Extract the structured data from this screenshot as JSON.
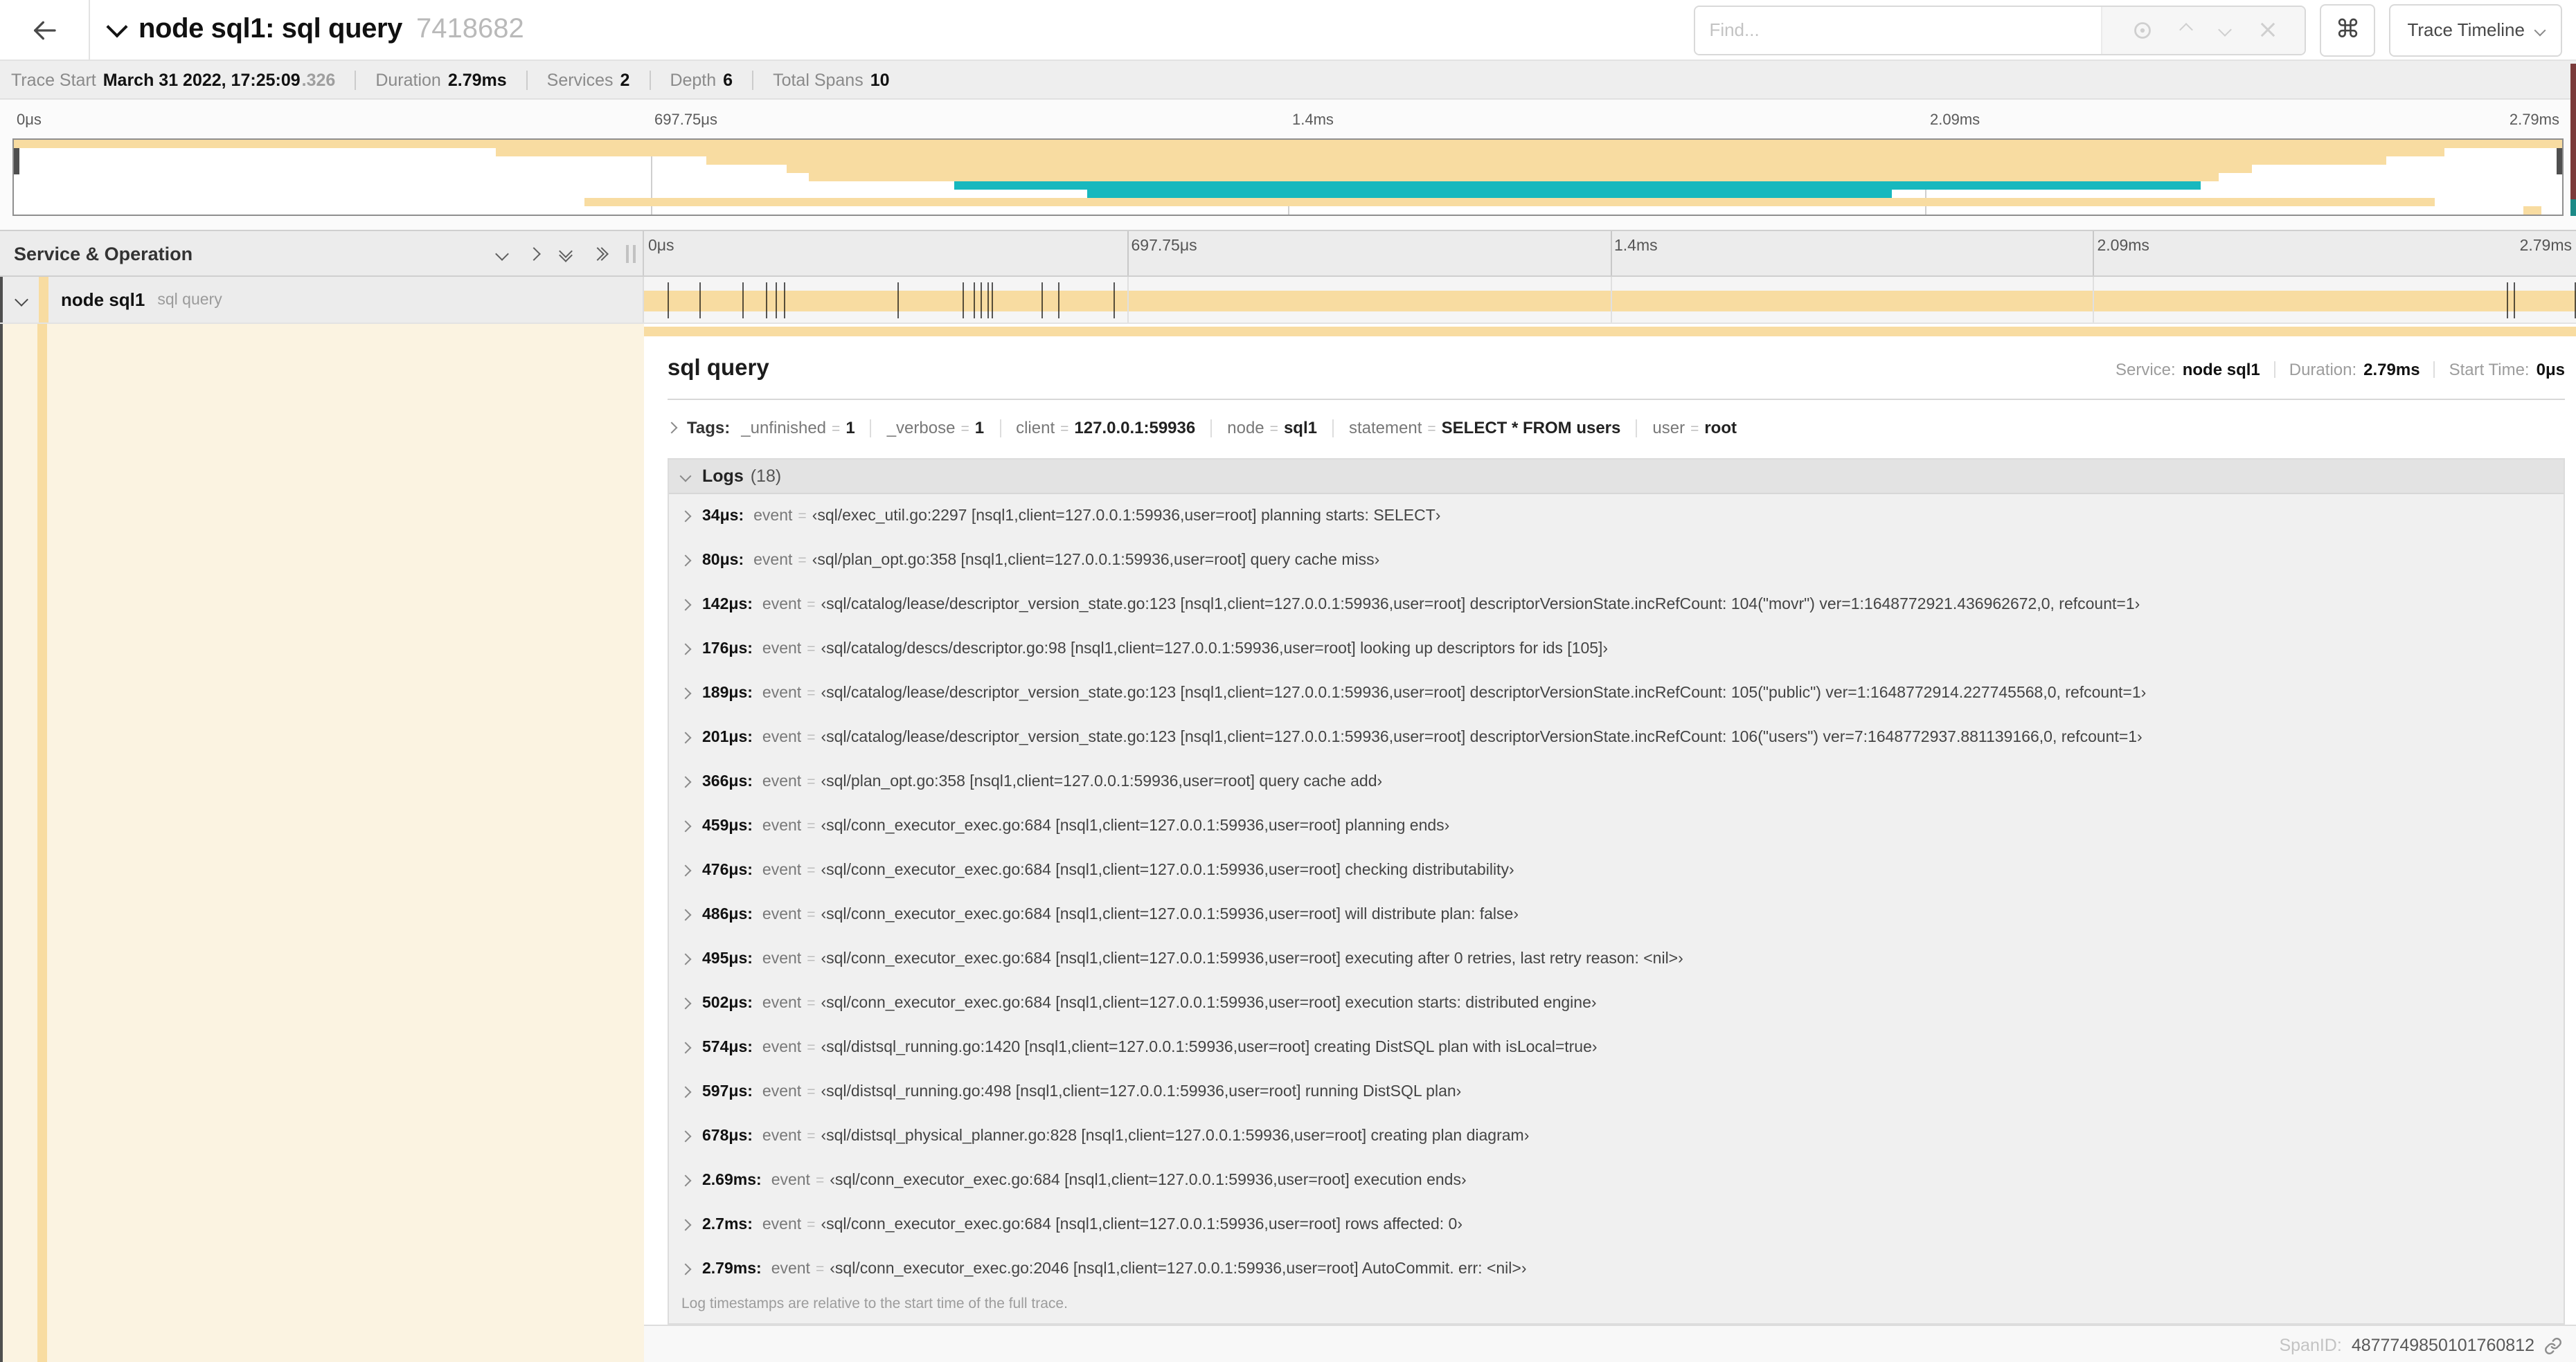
{
  "colors": {
    "tan": "#F8DCA1",
    "teal": "#17B8BE",
    "service_accent": "#F8DCA1"
  },
  "header": {
    "title_service": "node sql1: sql query",
    "trace_id_short": "7418682",
    "find_placeholder": "Find...",
    "shortcut_icon": "⌘",
    "view_selector": "Trace Timeline"
  },
  "summary": {
    "items": [
      {
        "label": "Trace Start",
        "value": "March 31 2022, 17:25:09",
        "suffix": ".326"
      },
      {
        "label": "Duration",
        "value": "2.79ms"
      },
      {
        "label": "Services",
        "value": "2"
      },
      {
        "label": "Depth",
        "value": "6"
      },
      {
        "label": "Total Spans",
        "value": "10"
      }
    ]
  },
  "timeline": {
    "ticks": [
      "0μs",
      "697.75μs",
      "1.4ms",
      "2.09ms",
      "2.79ms"
    ],
    "total_duration_us": 2790,
    "minimap_spans": [
      {
        "row": 0,
        "start": 0,
        "end": 100,
        "color": "tan"
      },
      {
        "row": 1,
        "start": 18.9,
        "end": 95.4,
        "color": "tan"
      },
      {
        "row": 2,
        "start": 27.2,
        "end": 93.1,
        "color": "tan"
      },
      {
        "row": 3,
        "start": 30.3,
        "end": 87.8,
        "color": "tan"
      },
      {
        "row": 4,
        "start": 31.2,
        "end": 86.5,
        "color": "tan"
      },
      {
        "row": 5,
        "start": 36.9,
        "end": 85.8,
        "color": "teal"
      },
      {
        "row": 6,
        "start": 42.1,
        "end": 73.7,
        "color": "teal"
      },
      {
        "row": 7,
        "start": 22.4,
        "end": 95.0,
        "color": "tan"
      },
      {
        "row": 8,
        "start": 98.5,
        "end": 99.2,
        "color": "tan"
      }
    ]
  },
  "span_table": {
    "header_left": "Service & Operation",
    "row": {
      "service": "node sql1",
      "operation": "sql query"
    }
  },
  "detail": {
    "operation": "sql query",
    "fields": [
      {
        "label": "Service:",
        "value": "node sql1"
      },
      {
        "label": "Duration:",
        "value": "2.79ms"
      },
      {
        "label": "Start Time:",
        "value": "0μs"
      }
    ],
    "tags_label": "Tags:",
    "equals_sign": "=",
    "tags": [
      {
        "key": "_unfinished",
        "value": "1"
      },
      {
        "key": "_verbose",
        "value": "1"
      },
      {
        "key": "client",
        "value": "127.0.0.1:59936"
      },
      {
        "key": "node",
        "value": "sql1"
      },
      {
        "key": "statement",
        "value": "SELECT * FROM users"
      },
      {
        "key": "user",
        "value": "root"
      }
    ],
    "logs_label": "Logs",
    "logs_count": "(18)",
    "logs": [
      {
        "time": "34μs:",
        "t_us": 34,
        "field": "event",
        "value": "‹sql/exec_util.go:2297 [nsql1,client=127.0.0.1:59936,user=root] planning starts: SELECT›"
      },
      {
        "time": "80μs:",
        "t_us": 80,
        "field": "event",
        "value": "‹sql/plan_opt.go:358 [nsql1,client=127.0.0.1:59936,user=root] query cache miss›"
      },
      {
        "time": "142μs:",
        "t_us": 142,
        "field": "event",
        "value": "‹sql/catalog/lease/descriptor_version_state.go:123 [nsql1,client=127.0.0.1:59936,user=root] descriptorVersionState.incRefCount: 104(\"movr\") ver=1:1648772921.436962672,0, refcount=1›"
      },
      {
        "time": "176μs:",
        "t_us": 176,
        "field": "event",
        "value": "‹sql/catalog/descs/descriptor.go:98 [nsql1,client=127.0.0.1:59936,user=root] looking up descriptors for ids [105]›"
      },
      {
        "time": "189μs:",
        "t_us": 189,
        "field": "event",
        "value": "‹sql/catalog/lease/descriptor_version_state.go:123 [nsql1,client=127.0.0.1:59936,user=root] descriptorVersionState.incRefCount: 105(\"public\") ver=1:1648772914.227745568,0, refcount=1›"
      },
      {
        "time": "201μs:",
        "t_us": 201,
        "field": "event",
        "value": "‹sql/catalog/lease/descriptor_version_state.go:123 [nsql1,client=127.0.0.1:59936,user=root] descriptorVersionState.incRefCount: 106(\"users\") ver=7:1648772937.881139166,0, refcount=1›"
      },
      {
        "time": "366μs:",
        "t_us": 366,
        "field": "event",
        "value": "‹sql/plan_opt.go:358 [nsql1,client=127.0.0.1:59936,user=root] query cache add›"
      },
      {
        "time": "459μs:",
        "t_us": 459,
        "field": "event",
        "value": "‹sql/conn_executor_exec.go:684 [nsql1,client=127.0.0.1:59936,user=root] planning ends›"
      },
      {
        "time": "476μs:",
        "t_us": 476,
        "field": "event",
        "value": "‹sql/conn_executor_exec.go:684 [nsql1,client=127.0.0.1:59936,user=root] checking distributability›"
      },
      {
        "time": "486μs:",
        "t_us": 486,
        "field": "event",
        "value": "‹sql/conn_executor_exec.go:684 [nsql1,client=127.0.0.1:59936,user=root] will distribute plan: false›"
      },
      {
        "time": "495μs:",
        "t_us": 495,
        "field": "event",
        "value": "‹sql/conn_executor_exec.go:684 [nsql1,client=127.0.0.1:59936,user=root] executing after 0 retries, last retry reason: <nil>›"
      },
      {
        "time": "502μs:",
        "t_us": 502,
        "field": "event",
        "value": "‹sql/conn_executor_exec.go:684 [nsql1,client=127.0.0.1:59936,user=root] execution starts: distributed engine›"
      },
      {
        "time": "574μs:",
        "t_us": 574,
        "field": "event",
        "value": "‹sql/distsql_running.go:1420 [nsql1,client=127.0.0.1:59936,user=root] creating DistSQL plan with isLocal=true›"
      },
      {
        "time": "597μs:",
        "t_us": 597,
        "field": "event",
        "value": "‹sql/distsql_running.go:498 [nsql1,client=127.0.0.1:59936,user=root] running DistSQL plan›"
      },
      {
        "time": "678μs:",
        "t_us": 678,
        "field": "event",
        "value": "‹sql/distsql_physical_planner.go:828 [nsql1,client=127.0.0.1:59936,user=root] creating plan diagram›"
      },
      {
        "time": "2.69ms:",
        "t_us": 2690,
        "field": "event",
        "value": "‹sql/conn_executor_exec.go:684 [nsql1,client=127.0.0.1:59936,user=root] execution ends›"
      },
      {
        "time": "2.7ms:",
        "t_us": 2700,
        "field": "event",
        "value": "‹sql/conn_executor_exec.go:684 [nsql1,client=127.0.0.1:59936,user=root] rows affected: 0›"
      },
      {
        "time": "2.79ms:",
        "t_us": 2790,
        "field": "event",
        "value": "‹sql/conn_executor_exec.go:2046 [nsql1,client=127.0.0.1:59936,user=root] AutoCommit. err: <nil>›"
      }
    ],
    "logs_footnote": "Log timestamps are relative to the start time of the full trace.",
    "spanid_label": "SpanID:",
    "spanid_value": "4877749850101760812"
  }
}
